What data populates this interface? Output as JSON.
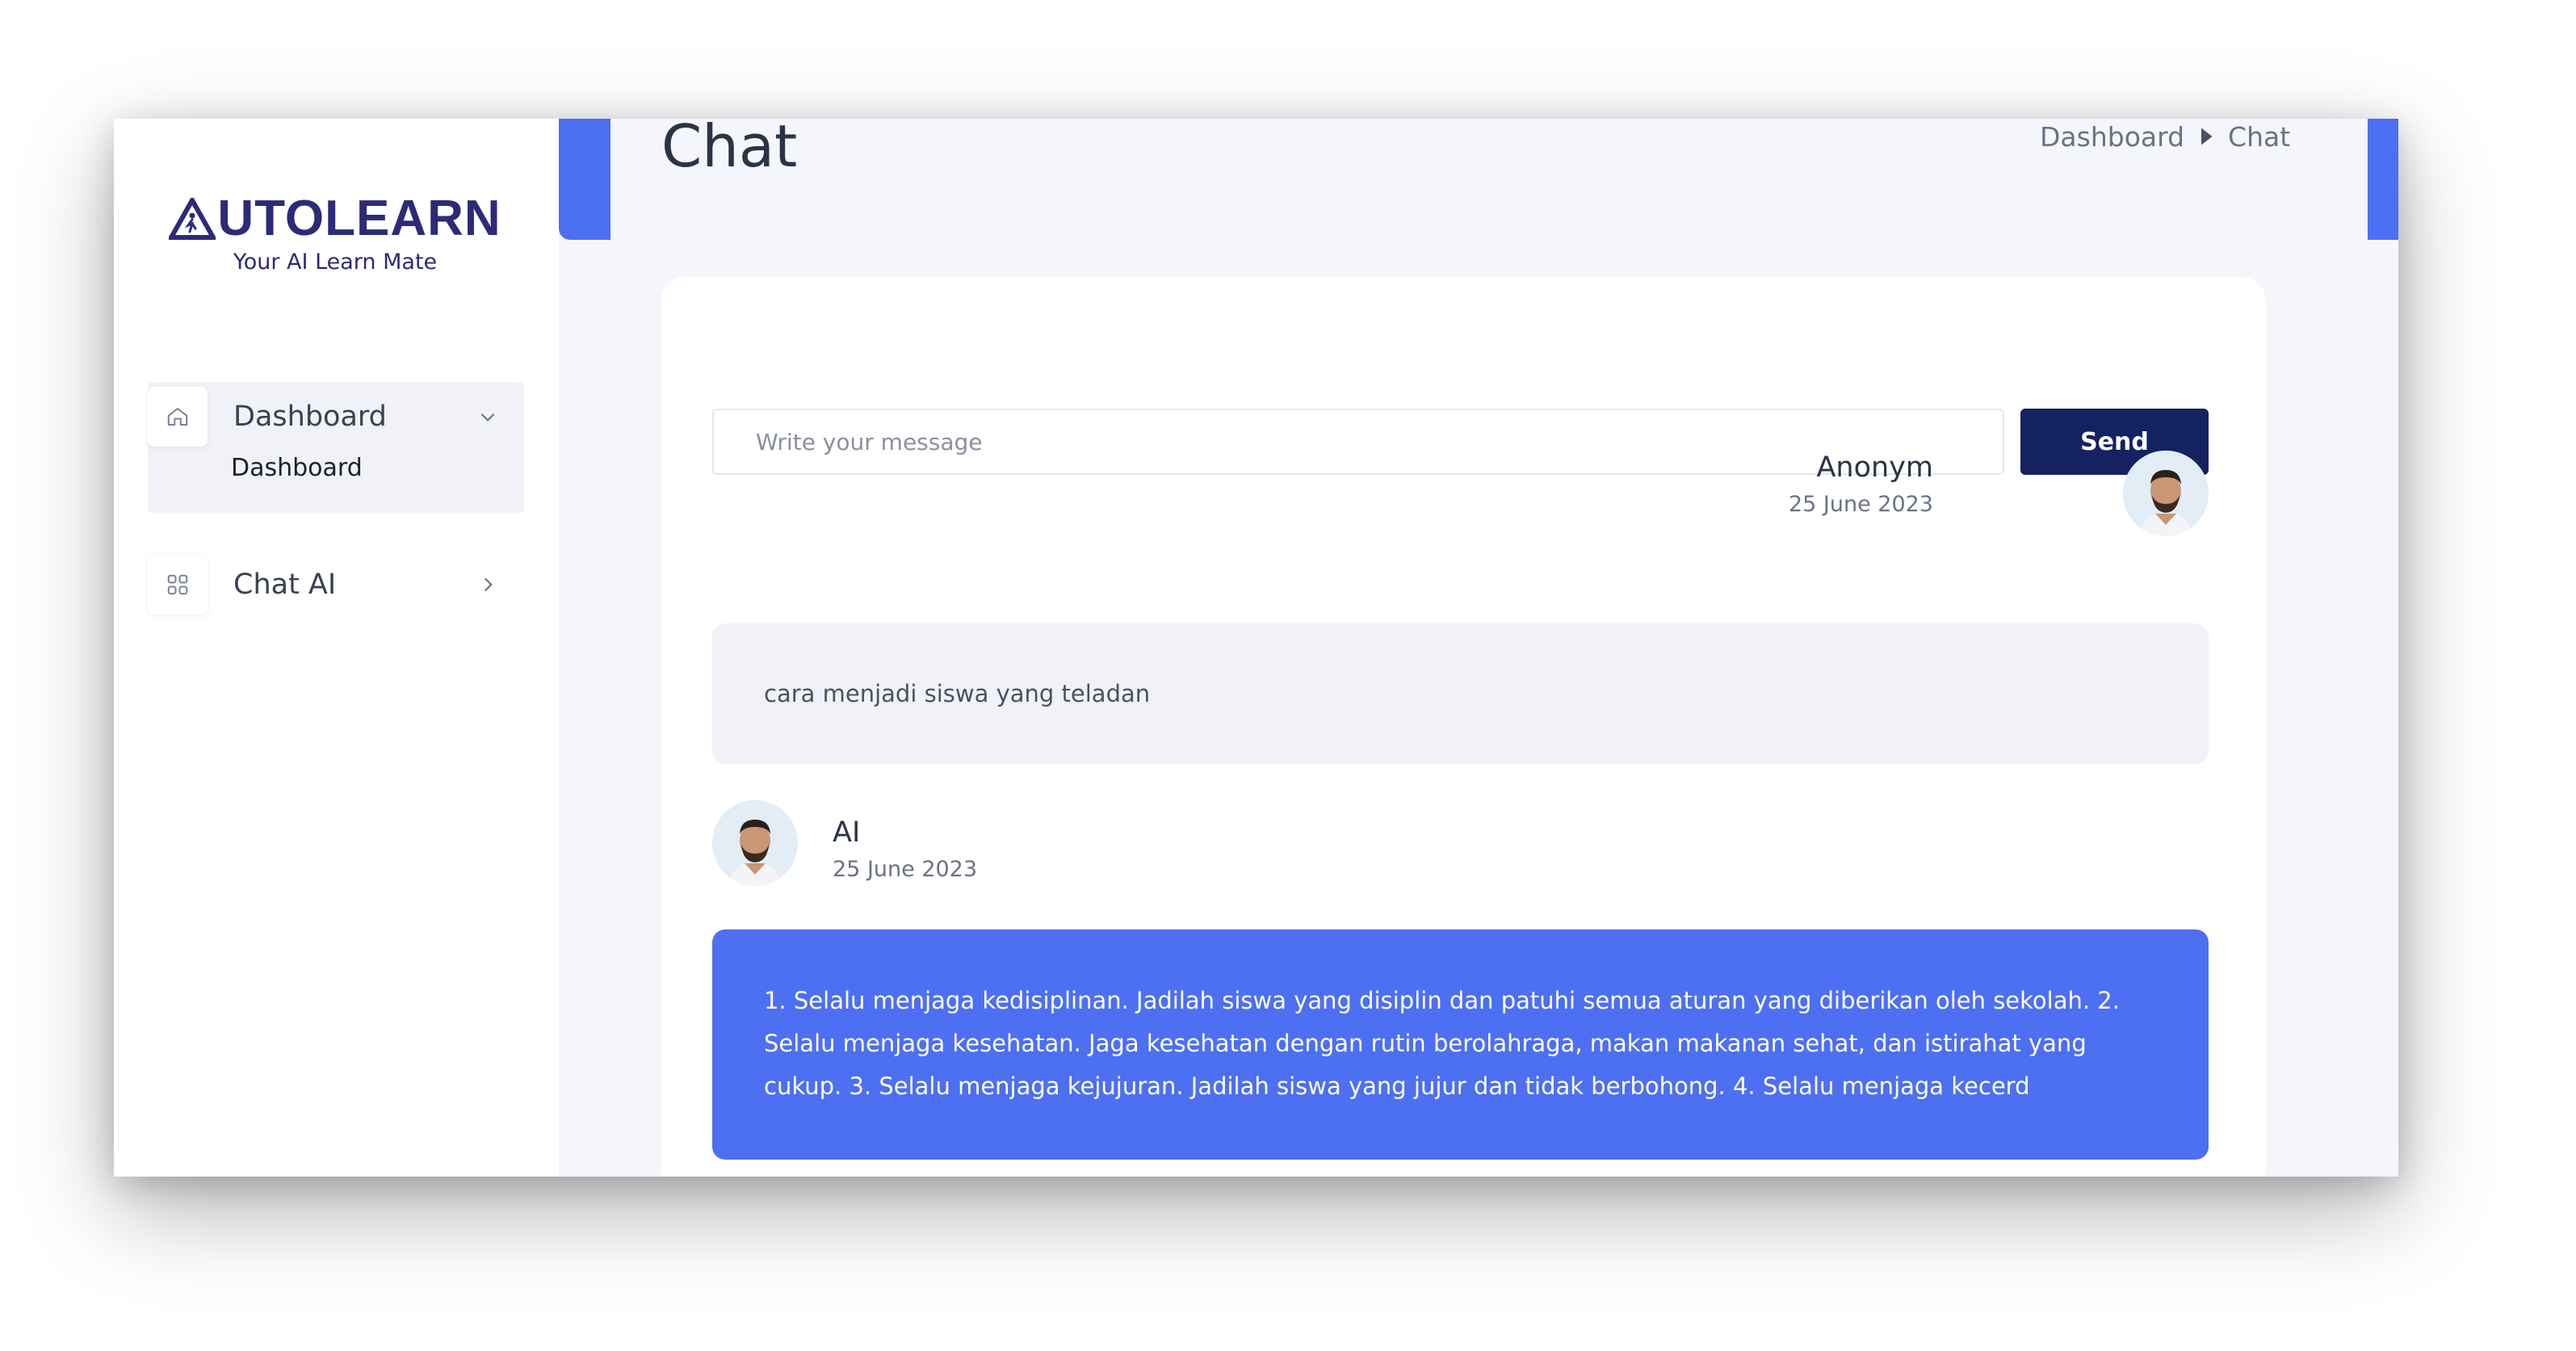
{
  "brand": {
    "name_rest": "UTOLEARN",
    "tagline": "Your AI Learn Mate",
    "primary": "#2d2a78",
    "accent": "#4d6ff2",
    "button": "#152262"
  },
  "sidebar": {
    "items": [
      {
        "label": "Dashboard",
        "icon": "home-icon",
        "chevron": "chevron-down-icon",
        "sub": "Dashboard"
      },
      {
        "label": "Chat AI",
        "icon": "grid-icon",
        "chevron": "chevron-right-icon"
      }
    ]
  },
  "header": {
    "title": "Chat",
    "breadcrumb": [
      "Dashboard",
      "Chat"
    ]
  },
  "composer": {
    "placeholder": "Write your message",
    "send_label": "Send"
  },
  "messages": [
    {
      "sender": "Anonym",
      "date": "25 June 2023",
      "text": "cara menjadi siswa yang teladan"
    },
    {
      "sender": "AI",
      "date": "25 June 2023",
      "text": "1. Selalu menjaga kedisiplinan. Jadilah siswa yang disiplin dan patuhi semua aturan yang diberikan oleh sekolah. 2. Selalu menjaga kesehatan. Jaga kesehatan dengan rutin berolahraga, makan makanan sehat, dan istirahat yang cukup. 3. Selalu menjaga kejujuran. Jadilah siswa yang jujur dan tidak berbohong. 4. Selalu menjaga kecerd"
    }
  ]
}
